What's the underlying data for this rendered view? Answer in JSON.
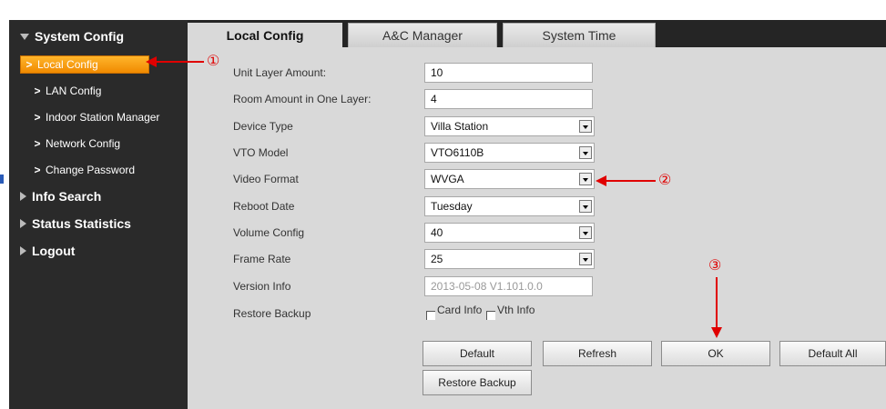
{
  "sidebar": {
    "sections": [
      {
        "label": "System Config",
        "icon": "triangle-down-icon"
      },
      {
        "label": "Info Search",
        "icon": "triangle-right-icon"
      },
      {
        "label": "Status Statistics",
        "icon": "triangle-right-icon"
      },
      {
        "label": "Logout",
        "icon": "triangle-right-icon"
      }
    ],
    "items": [
      {
        "label": "Local Config",
        "active": true
      },
      {
        "label": "LAN Config"
      },
      {
        "label": "Indoor Station Manager"
      },
      {
        "label": "Network Config"
      },
      {
        "label": "Change Password"
      }
    ]
  },
  "tabs": [
    {
      "label": "Local Config",
      "active": true
    },
    {
      "label": "A&C Manager"
    },
    {
      "label": "System Time"
    }
  ],
  "form": {
    "unit_layer_amount": {
      "label": "Unit Layer Amount:",
      "value": "10"
    },
    "room_amount": {
      "label": "Room Amount in One Layer:",
      "value": "4"
    },
    "device_type": {
      "label": "Device Type",
      "value": "Villa Station"
    },
    "vto_model": {
      "label": "VTO Model",
      "value": "VTO6110B"
    },
    "video_format": {
      "label": "Video Format",
      "value": "WVGA"
    },
    "reboot_date": {
      "label": "Reboot Date",
      "value": "Tuesday"
    },
    "volume_config": {
      "label": "Volume Config",
      "value": "40"
    },
    "frame_rate": {
      "label": "Frame Rate",
      "value": "25"
    },
    "version_info": {
      "label": "Version Info",
      "value": "2013-05-08 V1.101.0.0"
    },
    "restore_backup": {
      "label": "Restore Backup",
      "card_info": "Card Info",
      "vth_info": "Vth Info"
    }
  },
  "buttons": {
    "default": "Default",
    "refresh": "Refresh",
    "ok": "OK",
    "default_all": "Default All",
    "restore_backup": "Restore Backup"
  },
  "annotations": {
    "one": "①",
    "two": "②",
    "three": "③"
  },
  "colors": {
    "accent": "#f08a00",
    "annotation": "#e00000",
    "sidebar_bg": "#2a2a2a",
    "panel_bg": "#d9d9d9"
  }
}
